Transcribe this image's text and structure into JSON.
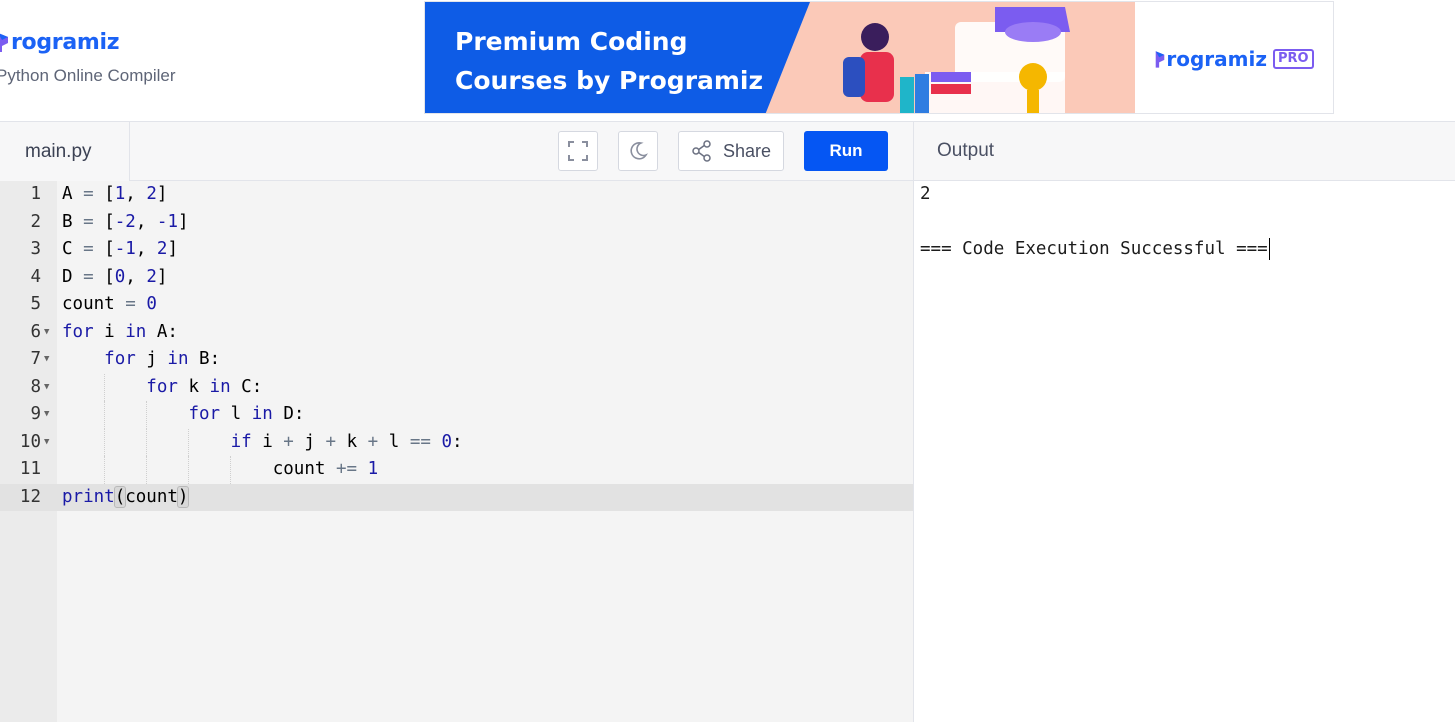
{
  "brand": {
    "name": "rogramiz",
    "subtitle": "Python Online Compiler"
  },
  "ad": {
    "line1": "Premium Coding",
    "line2": "Courses by Programiz",
    "pro_name": "rogramiz",
    "pro_badge": "PRO",
    "brand_color": "#0e5ce6"
  },
  "toolbar": {
    "file_tab": "main.py",
    "fullscreen_icon": "expand-icon",
    "theme_icon": "moon-icon",
    "share_label": "Share",
    "share_icon": "share-icon",
    "run_label": "Run",
    "run_color": "#0556f3"
  },
  "output_panel": {
    "title": "Output",
    "lines": [
      "2",
      "",
      "=== Code Execution Successful ==="
    ]
  },
  "editor": {
    "active_line": 12,
    "lines": [
      {
        "n": "1",
        "fold": false
      },
      {
        "n": "2",
        "fold": false
      },
      {
        "n": "3",
        "fold": false
      },
      {
        "n": "4",
        "fold": false
      },
      {
        "n": "5",
        "fold": false
      },
      {
        "n": "6",
        "fold": true
      },
      {
        "n": "7",
        "fold": true
      },
      {
        "n": "8",
        "fold": true
      },
      {
        "n": "9",
        "fold": true
      },
      {
        "n": "10",
        "fold": true
      },
      {
        "n": "11",
        "fold": false
      },
      {
        "n": "12",
        "fold": false
      }
    ],
    "tokens": {
      "l1": [
        "A",
        "=",
        "[",
        "1",
        ",",
        "2",
        "]"
      ],
      "l2": [
        "B",
        "=",
        "[",
        "-2",
        ",",
        "-1",
        "]"
      ],
      "l3": [
        "C",
        "=",
        "[",
        "-1",
        ",",
        "2",
        "]"
      ],
      "l4": [
        "D",
        "=",
        "[",
        "0",
        ",",
        "2",
        "]"
      ],
      "l5": [
        "count",
        "=",
        "0"
      ],
      "l6": [
        "for",
        "i",
        "in",
        "A:"
      ],
      "l7": [
        "for",
        "j",
        "in",
        "B:"
      ],
      "l8": [
        "for",
        "k",
        "in",
        "C:"
      ],
      "l9": [
        "for",
        "l",
        "in",
        "D:"
      ],
      "l10": [
        "if",
        "i",
        "+",
        "j",
        "+",
        "k",
        "+",
        "l",
        "==",
        "0",
        ":"
      ],
      "l11": [
        "count",
        "+=",
        "1"
      ],
      "l12": [
        "print",
        "(",
        "count",
        ")"
      ]
    }
  }
}
